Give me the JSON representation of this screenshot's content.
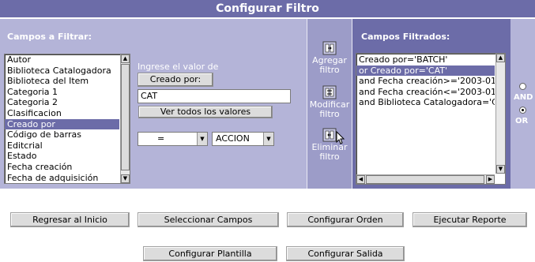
{
  "title": "Configurar Filtro",
  "campos_a_filtrar": {
    "label": "Campos a Filtrar:",
    "items": [
      "Autor",
      "Biblioteca Catalogadora",
      "Biblioteca del Item",
      "Categoria 1",
      "Categoria 2",
      "Clasificacion",
      "Creado por",
      "Código de barras",
      "Editcrial",
      "Estado",
      "Fecha creación",
      "Fecha de adquisición"
    ],
    "selected_index": 6
  },
  "value_entry": {
    "label": "Ingrese el valor de",
    "field_button": "Creado por:",
    "value": "CAT",
    "view_all": "Ver todos los valores",
    "operator": "=",
    "action": "ACCION"
  },
  "actions": {
    "add": "Agregar filtro",
    "modify": "Modificar filtro",
    "delete": "Eliminar filtro"
  },
  "campos_filtrados": {
    "label": "Campos Filtrados:",
    "items": [
      "Creado por='BATCH'",
      "or Creado por='CAT'",
      "and Fecha creación>='2003-01",
      "and Fecha creación<='2003-01",
      "and Biblioteca Catalogadora='C"
    ],
    "selected_index": 1
  },
  "logic": {
    "and_label": "AND",
    "or_label": "OR",
    "selected": "OR"
  },
  "buttons": {
    "regresar": "Regresar al Inicio",
    "seleccionar": "Seleccionar Campos",
    "orden": "Configurar Orden",
    "ejecutar": "Ejecutar Reporte",
    "plantilla": "Configurar Plantilla",
    "salida": "Configurar Salida"
  },
  "colors": {
    "header": "#6c6ca8",
    "panel": "#b4b4d8",
    "selected": "#6c6ca8"
  }
}
